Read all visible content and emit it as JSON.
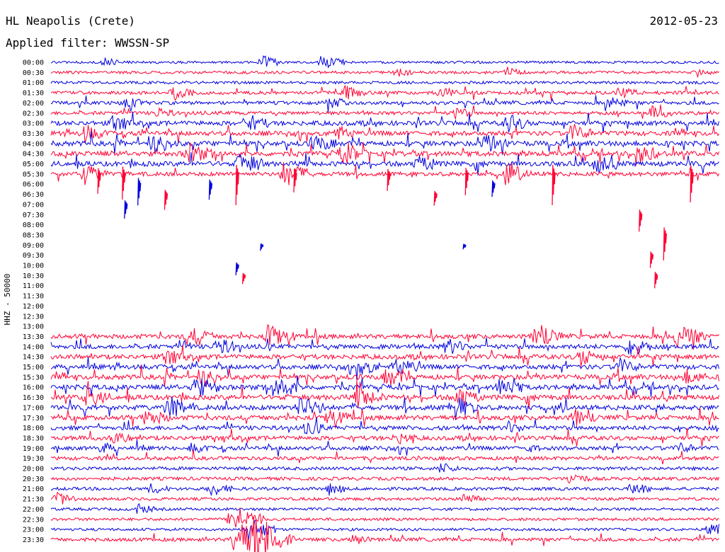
{
  "header": {
    "station": "HL Neapolis (Crete)",
    "date": "2012-05-23",
    "filter": "Applied filter: WWSSN-SP"
  },
  "channel_label": "HHZ - 50000",
  "chart_data": {
    "type": "line",
    "title": "HL Neapolis (Crete)",
    "date": "2012-05-23",
    "filter": "WWSSN-SP",
    "ylabel": "HHZ - 50000",
    "x_unit": "minutes within row",
    "xlim": [
      0,
      30
    ],
    "row_labels": [
      "00:00",
      "00:30",
      "01:00",
      "01:30",
      "02:00",
      "02:30",
      "03:00",
      "03:30",
      "04:00",
      "04:30",
      "05:00",
      "05:30",
      "06:00",
      "06:30",
      "07:00",
      "07:30",
      "08:00",
      "08:30",
      "09:00",
      "09:30",
      "10:00",
      "10:30",
      "11:00",
      "11:30",
      "12:00",
      "12:30",
      "13:00",
      "13:30",
      "14:00",
      "14:30",
      "15:00",
      "15:30",
      "16:00",
      "16:30",
      "17:00",
      "17:30",
      "18:00",
      "18:30",
      "19:00",
      "19:30",
      "20:00",
      "20:30",
      "21:00",
      "21:30",
      "22:00",
      "22:30",
      "23:00",
      "23:30"
    ],
    "series_colors": [
      "#0000dd",
      "#ff0033"
    ],
    "row_activity": [
      0.25,
      0.35,
      0.35,
      0.55,
      0.55,
      0.55,
      0.9,
      0.9,
      1.0,
      1.0,
      1.0,
      0.75,
      0.45,
      0.2,
      0.15,
      0.12,
      0.08,
      0.05,
      0.05,
      0.03,
      0.03,
      0.05,
      0.03,
      0.02,
      0.02,
      0.03,
      0.05,
      0.85,
      0.9,
      0.9,
      0.9,
      0.95,
      1.0,
      1.0,
      1.0,
      0.9,
      0.8,
      0.8,
      0.7,
      0.6,
      0.5,
      0.5,
      0.45,
      0.4,
      0.35,
      0.35,
      0.3,
      0.55
    ],
    "row_visible": [
      true,
      true,
      true,
      true,
      true,
      true,
      true,
      true,
      true,
      true,
      true,
      true,
      false,
      false,
      false,
      false,
      false,
      false,
      false,
      false,
      false,
      false,
      false,
      false,
      false,
      false,
      false,
      true,
      true,
      true,
      true,
      true,
      true,
      true,
      true,
      true,
      true,
      true,
      true,
      true,
      true,
      true,
      true,
      true,
      true,
      true,
      true,
      true
    ],
    "bursts": [
      {
        "row": 0,
        "minute": 9.5,
        "amp": 10
      },
      {
        "row": 0,
        "minute": 12.2,
        "amp": 12
      },
      {
        "row": 0,
        "minute": 2.4,
        "amp": 6
      },
      {
        "row": 1,
        "minute": 15.5,
        "amp": 6
      },
      {
        "row": 1,
        "minute": 20.5,
        "amp": 7
      },
      {
        "row": 1,
        "minute": 29,
        "amp": 5
      },
      {
        "row": 3,
        "minute": 5.5,
        "amp": 10
      },
      {
        "row": 3,
        "minute": 13.2,
        "amp": 9
      },
      {
        "row": 3,
        "minute": 17.5,
        "amp": 8
      },
      {
        "row": 3,
        "minute": 25.5,
        "amp": 8
      },
      {
        "row": 4,
        "minute": 3.3,
        "amp": 9
      },
      {
        "row": 4,
        "minute": 12.5,
        "amp": 9
      },
      {
        "row": 4,
        "minute": 25,
        "amp": 10
      },
      {
        "row": 5,
        "minute": 4.8,
        "amp": 7
      },
      {
        "row": 5,
        "minute": 18.2,
        "amp": 8
      },
      {
        "row": 5,
        "minute": 27,
        "amp": 9
      },
      {
        "row": 6,
        "minute": 2.8,
        "amp": 10
      },
      {
        "row": 6,
        "minute": 8.8,
        "amp": 12
      },
      {
        "row": 6,
        "minute": 20.5,
        "amp": 12
      },
      {
        "row": 7,
        "minute": 1.5,
        "amp": 12
      },
      {
        "row": 7,
        "minute": 12.8,
        "amp": 11
      },
      {
        "row": 7,
        "minute": 23.4,
        "amp": 12
      },
      {
        "row": 8,
        "minute": 4.6,
        "amp": 14
      },
      {
        "row": 8,
        "minute": 11.8,
        "amp": 12
      },
      {
        "row": 8,
        "minute": 19.5,
        "amp": 13
      },
      {
        "row": 9,
        "minute": 6.2,
        "amp": 14
      },
      {
        "row": 9,
        "minute": 13.1,
        "amp": 15
      },
      {
        "row": 9,
        "minute": 26.4,
        "amp": 13
      },
      {
        "row": 10,
        "minute": 8.5,
        "amp": 16
      },
      {
        "row": 10,
        "minute": 16.5,
        "amp": 12
      },
      {
        "row": 10,
        "minute": 24.5,
        "amp": 12
      },
      {
        "row": 11,
        "minute": 1.5,
        "amp": 14
      },
      {
        "row": 11,
        "minute": 10.5,
        "amp": 18
      },
      {
        "row": 11,
        "minute": 20.5,
        "amp": 14
      },
      {
        "row": 27,
        "minute": 6.2,
        "amp": 14
      },
      {
        "row": 27,
        "minute": 9.8,
        "amp": 16
      },
      {
        "row": 27,
        "minute": 21.8,
        "amp": 16
      },
      {
        "row": 27,
        "minute": 28.2,
        "amp": 18
      },
      {
        "row": 28,
        "minute": 7.5,
        "amp": 12
      },
      {
        "row": 28,
        "minute": 17.8,
        "amp": 11
      },
      {
        "row": 28,
        "minute": 26,
        "amp": 12
      },
      {
        "row": 29,
        "minute": 5.2,
        "amp": 10
      },
      {
        "row": 29,
        "minute": 23.8,
        "amp": 12
      },
      {
        "row": 30,
        "minute": 13.8,
        "amp": 12
      },
      {
        "row": 30,
        "minute": 15.5,
        "amp": 13
      },
      {
        "row": 30,
        "minute": 25.5,
        "amp": 11
      },
      {
        "row": 31,
        "minute": 6.8,
        "amp": 12
      },
      {
        "row": 31,
        "minute": 15.1,
        "amp": 12
      },
      {
        "row": 31,
        "minute": 28.5,
        "amp": 10
      },
      {
        "row": 32,
        "minute": 6.5,
        "amp": 15
      },
      {
        "row": 32,
        "minute": 10.2,
        "amp": 14
      },
      {
        "row": 32,
        "minute": 20.2,
        "amp": 14
      },
      {
        "row": 33,
        "minute": 1.6,
        "amp": 13
      },
      {
        "row": 33,
        "minute": 13.8,
        "amp": 15
      },
      {
        "row": 33,
        "minute": 18.3,
        "amp": 14
      },
      {
        "row": 34,
        "minute": 5.3,
        "amp": 15
      },
      {
        "row": 34,
        "minute": 11.2,
        "amp": 16
      },
      {
        "row": 34,
        "minute": 18.1,
        "amp": 16
      },
      {
        "row": 35,
        "minute": 4.3,
        "amp": 12
      },
      {
        "row": 35,
        "minute": 12.5,
        "amp": 12
      },
      {
        "row": 35,
        "minute": 23.5,
        "amp": 11
      },
      {
        "row": 36,
        "minute": 11.5,
        "amp": 10
      },
      {
        "row": 36,
        "minute": 20.5,
        "amp": 8
      },
      {
        "row": 37,
        "minute": 2.8,
        "amp": 8
      },
      {
        "row": 37,
        "minute": 15.5,
        "amp": 8
      },
      {
        "row": 38,
        "minute": 2.3,
        "amp": 7
      },
      {
        "row": 38,
        "minute": 6.3,
        "amp": 7
      },
      {
        "row": 38,
        "minute": 21.2,
        "amp": 6
      },
      {
        "row": 38,
        "minute": 28.2,
        "amp": 7
      },
      {
        "row": 40,
        "minute": 17.5,
        "amp": 8
      },
      {
        "row": 41,
        "minute": 23.3,
        "amp": 9
      },
      {
        "row": 42,
        "minute": 4.5,
        "amp": 7
      },
      {
        "row": 42,
        "minute": 7.2,
        "amp": 10
      },
      {
        "row": 42,
        "minute": 12.5,
        "amp": 8
      },
      {
        "row": 42,
        "minute": 26.1,
        "amp": 9
      },
      {
        "row": 43,
        "minute": 0.3,
        "amp": 10
      },
      {
        "row": 43,
        "minute": 18.5,
        "amp": 8
      },
      {
        "row": 44,
        "minute": 3.9,
        "amp": 7
      },
      {
        "row": 45,
        "minute": 8.2,
        "amp": 22
      },
      {
        "row": 46,
        "minute": 8.9,
        "amp": 18
      },
      {
        "row": 46,
        "minute": 29.6,
        "amp": 12
      },
      {
        "row": 47,
        "minute": 8.4,
        "amp": 26
      },
      {
        "row": 47,
        "minute": 9.2,
        "amp": 30
      },
      {
        "row": 47,
        "minute": 13.5,
        "amp": 8
      }
    ],
    "isolated_spikes": [
      {
        "row": 11,
        "minute": 2.1,
        "amp": 28
      },
      {
        "row": 11,
        "minute": 3.2,
        "amp": 36
      },
      {
        "row": 11,
        "minute": 8.3,
        "amp": 44
      },
      {
        "row": 11,
        "minute": 10.9,
        "amp": 26
      },
      {
        "row": 11,
        "minute": 15.1,
        "amp": 24
      },
      {
        "row": 11,
        "minute": 18.6,
        "amp": 30
      },
      {
        "row": 11,
        "minute": 22.5,
        "amp": 44
      },
      {
        "row": 11,
        "minute": 28.7,
        "amp": 40
      },
      {
        "row": 12,
        "minute": 3.9,
        "amp": 30
      },
      {
        "row": 12,
        "minute": 7.1,
        "amp": 22
      },
      {
        "row": 12,
        "minute": 19.8,
        "amp": 18
      },
      {
        "row": 13,
        "minute": 5.1,
        "amp": 22
      },
      {
        "row": 13,
        "minute": 17.2,
        "amp": 16
      },
      {
        "row": 14,
        "minute": 3.3,
        "amp": 20
      },
      {
        "row": 15,
        "minute": 26.4,
        "amp": 24
      },
      {
        "row": 17,
        "minute": 27.5,
        "amp": 36
      },
      {
        "row": 18,
        "minute": 9.4,
        "amp": 8
      },
      {
        "row": 18,
        "minute": 18.5,
        "amp": 6
      },
      {
        "row": 19,
        "minute": 26.9,
        "amp": 18
      },
      {
        "row": 20,
        "minute": 8.3,
        "amp": 14
      },
      {
        "row": 21,
        "minute": 8.6,
        "amp": 12
      },
      {
        "row": 21,
        "minute": 27.1,
        "amp": 18
      }
    ]
  }
}
